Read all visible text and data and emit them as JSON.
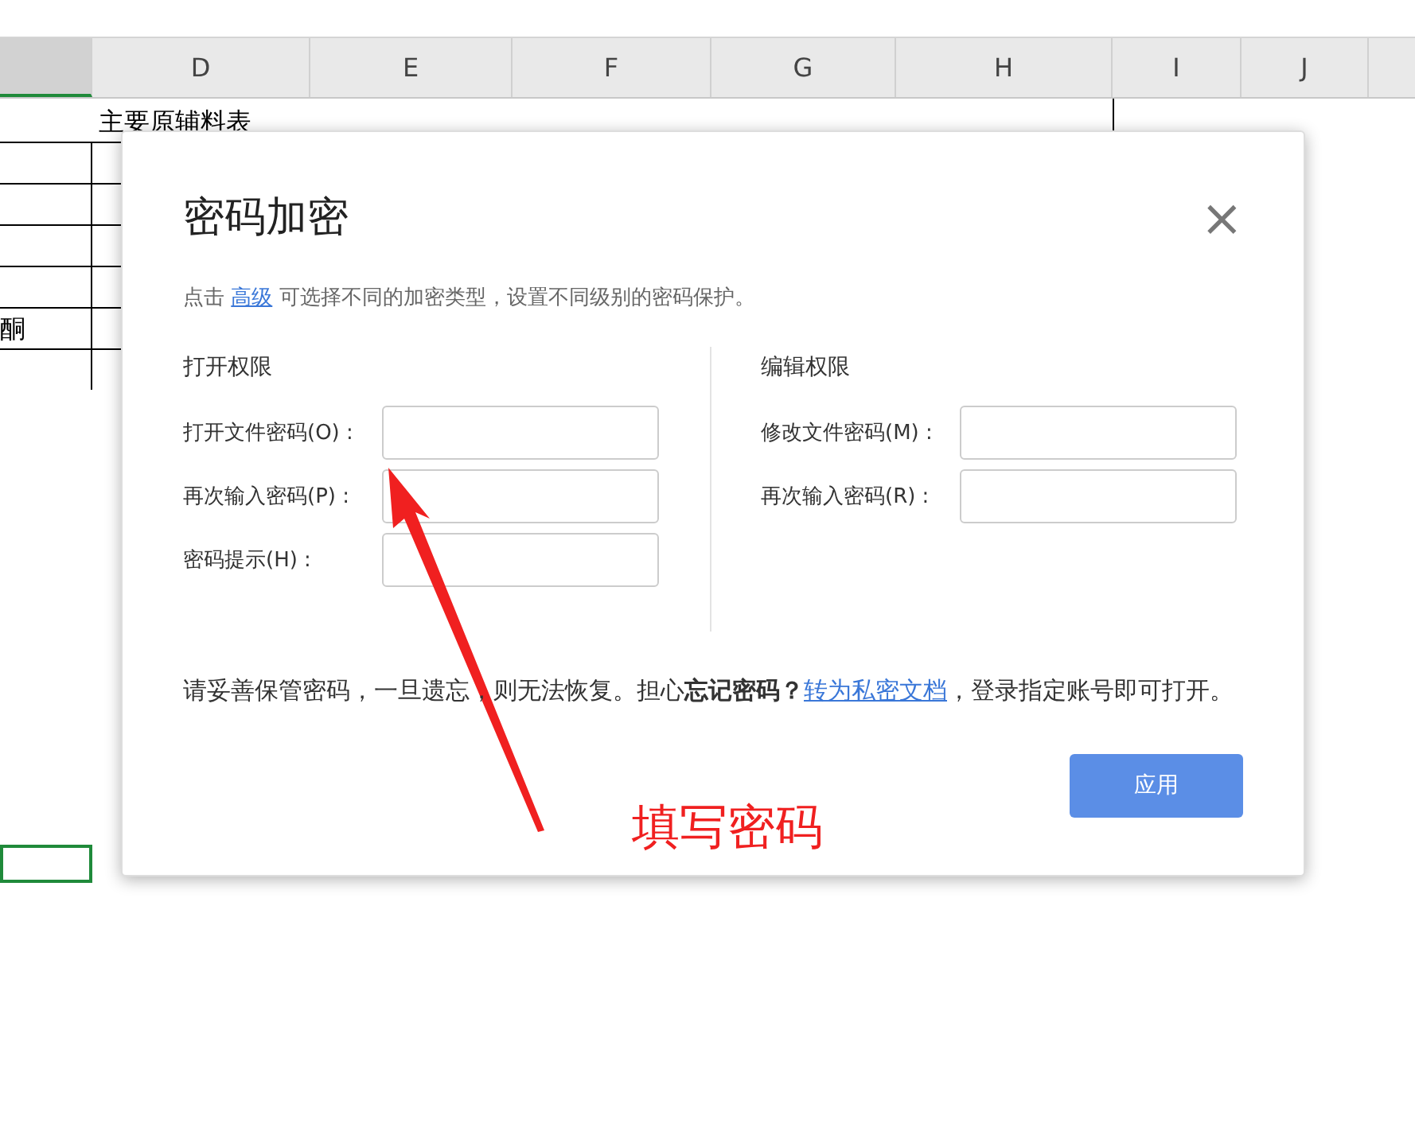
{
  "sheet": {
    "columns": [
      {
        "selected": true
      },
      {
        "label": "D",
        "selected": false
      },
      {
        "label": "E",
        "selected": false
      },
      {
        "label": "F",
        "selected": false
      },
      {
        "label": "G",
        "selected": false
      },
      {
        "label": "H",
        "selected": false
      },
      {
        "label": "I",
        "selected": false
      },
      {
        "label": "J",
        "selected": false
      }
    ],
    "title_cell": "主要原辅料表",
    "cell_text": "酮"
  },
  "dialog": {
    "title": "密码加密",
    "close": "×",
    "hint": {
      "before": "点击",
      "link": "高级",
      "after": "可选择不同的加密类型，设置不同级别的密码保护。"
    },
    "sections": [
      {
        "heading": "打开权限",
        "fields": [
          {
            "label": "打开文件密码(O) :"
          },
          {
            "label": "再次输入密码(P) :"
          },
          {
            "label": "密码提示(H) :"
          }
        ]
      },
      {
        "heading": "编辑权限",
        "fields": [
          {
            "label": "修改文件密码(M) :"
          },
          {
            "label": "再次输入密码(R) :"
          }
        ]
      }
    ],
    "note": {
      "before": "请妥善保管密码，一旦遗忘，则无法恢复。担心**忘记密码？**",
      "link": "转为私密文档",
      "after": "，登录指定账号即可打开。"
    },
    "apply": "应用"
  },
  "annotation": {
    "text": "填写密码"
  }
}
